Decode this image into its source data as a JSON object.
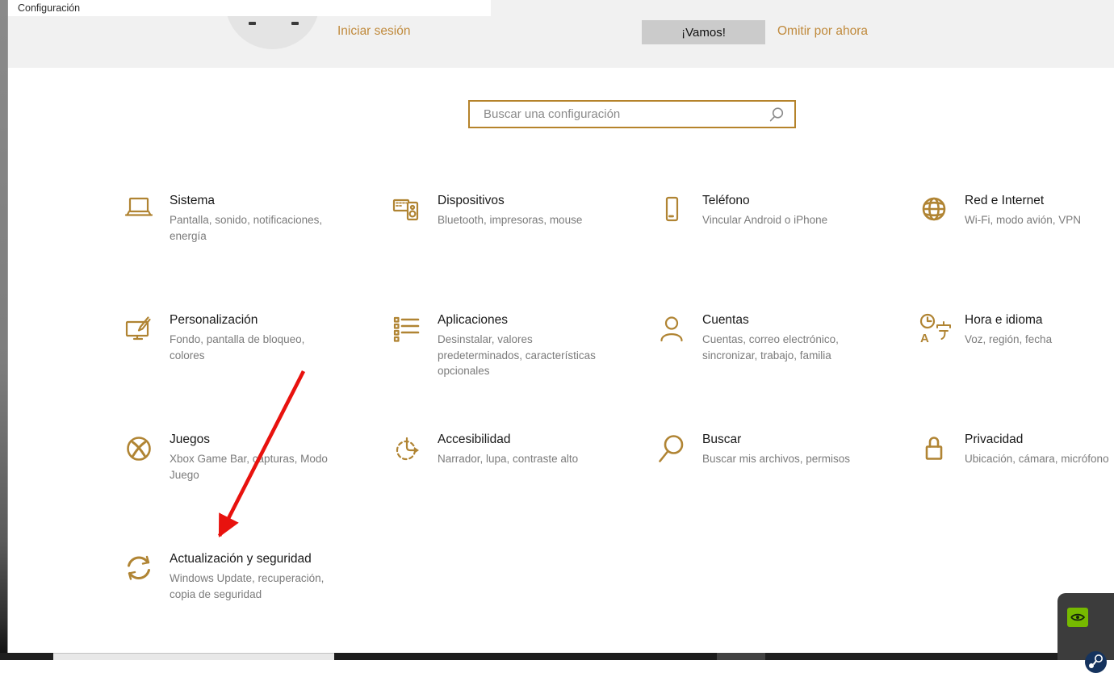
{
  "window": {
    "title": "Configuración"
  },
  "banner": {
    "sign_in_label": "Iniciar sesión",
    "cta_label": "¡Vamos!",
    "skip_label": "Omitir por ahora"
  },
  "search": {
    "placeholder": "Buscar una configuración",
    "icon": "search-icon"
  },
  "categories": [
    {
      "title": "Sistema",
      "subtitle": "Pantalla, sonido, notificaciones, energía",
      "icon": "laptop-icon"
    },
    {
      "title": "Dispositivos",
      "subtitle": "Bluetooth, impresoras, mouse",
      "icon": "devices-icon"
    },
    {
      "title": "Teléfono",
      "subtitle": "Vincular Android o iPhone",
      "icon": "phone-icon"
    },
    {
      "title": "Red e Internet",
      "subtitle": "Wi-Fi, modo avión, VPN",
      "icon": "globe-icon"
    },
    {
      "title": "Personalización",
      "subtitle": "Fondo, pantalla de bloqueo, colores",
      "icon": "personalization-icon"
    },
    {
      "title": "Aplicaciones",
      "subtitle": "Desinstalar, valores predeterminados, características opcionales",
      "icon": "apps-list-icon"
    },
    {
      "title": "Cuentas",
      "subtitle": "Cuentas, correo electrónico, sincronizar, trabajo, familia",
      "icon": "person-icon"
    },
    {
      "title": "Hora e idioma",
      "subtitle": "Voz, región, fecha",
      "icon": "time-language-icon"
    },
    {
      "title": "Juegos",
      "subtitle": "Xbox Game Bar, capturas, Modo Juego",
      "icon": "xbox-icon"
    },
    {
      "title": "Accesibilidad",
      "subtitle": "Narrador, lupa, contraste alto",
      "icon": "accessibility-icon"
    },
    {
      "title": "Buscar",
      "subtitle": "Buscar mis archivos, permisos",
      "icon": "magnifier-icon"
    },
    {
      "title": "Privacidad",
      "subtitle": "Ubicación, cámara, micrófono",
      "icon": "lock-icon"
    },
    {
      "title": "Actualización y seguridad",
      "subtitle": "Windows Update, recuperación, copia de seguridad",
      "icon": "refresh-icon"
    }
  ],
  "annotation": {
    "type": "arrow",
    "color": "#e8120e",
    "points_to": "Actualización y seguridad"
  },
  "tray": {
    "nvidia_icon": "nvidia-icon",
    "steam_icon": "steam-icon"
  },
  "colors": {
    "accent_gold": "#b5832b",
    "icon_gold": "#b08433",
    "link_gold": "#c08a3c",
    "banner_gray": "#f1f1f1",
    "cta_gray": "#cbcbcb",
    "subtitle_gray": "#7b7b7b",
    "arrow_red": "#e8120e",
    "nvidia_green": "#76b900",
    "steam_blue": "#15335e"
  }
}
